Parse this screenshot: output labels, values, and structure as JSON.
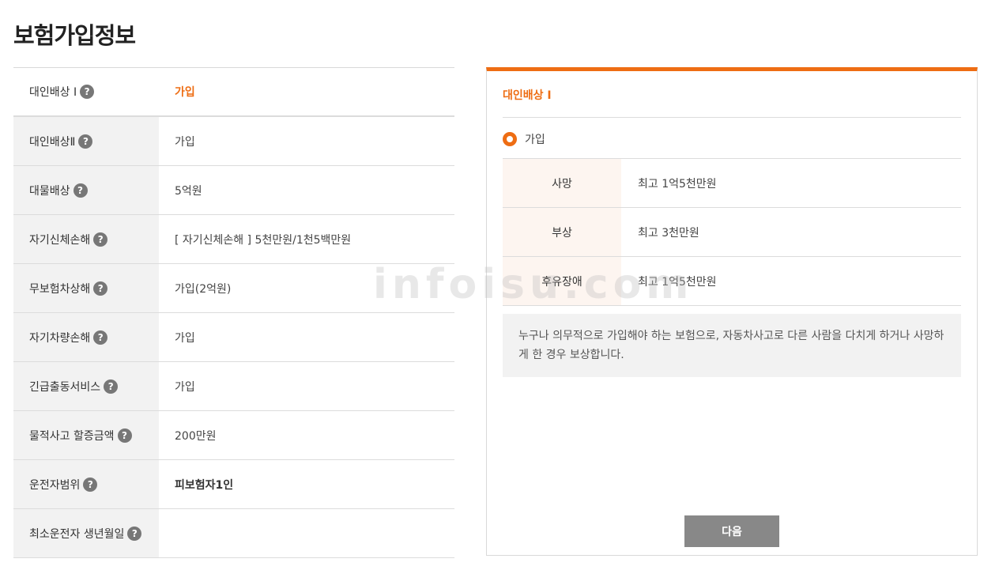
{
  "page_title": "보험가입정보",
  "coverage_rows": [
    {
      "label": "대인배상 Ⅰ",
      "value": "가입"
    },
    {
      "label": "대인배상Ⅱ",
      "value": "가입"
    },
    {
      "label": "대물배상",
      "value": "5억원"
    },
    {
      "label": "자기신체손해",
      "value": "[ 자기신체손해 ]  5천만원/1천5백만원"
    },
    {
      "label": "무보험차상해",
      "value": "가입(2억원)"
    },
    {
      "label": "자기차량손해",
      "value": "가입"
    },
    {
      "label": "긴급출동서비스",
      "value": "가입"
    },
    {
      "label": "물적사고 할증금액",
      "value": "200만원"
    },
    {
      "label": "운전자범위",
      "value": "피보험자1인"
    },
    {
      "label": "최소운전자 생년월일",
      "value": ""
    }
  ],
  "help_icon_glyph": "?",
  "panel": {
    "title": "대인배상 Ⅰ",
    "radio_label": "가입",
    "details": [
      {
        "label": "사망",
        "value": "최고 1억5천만원"
      },
      {
        "label": "부상",
        "value": "최고 3천만원"
      },
      {
        "label": "후유장애",
        "value": "최고 1억5천만원"
      }
    ],
    "description": "누구나 의무적으로 가입해야 하는 보험으로, 자동차사고로 다른 사람을 다치게 하거나 사망하게 한 경우 보상합니다.",
    "next_button": "다음"
  },
  "watermark": "infoisu.com",
  "colors": {
    "accent": "#ee6d13",
    "label_bg": "#f2f2f2",
    "detail_label_bg": "#fdf5f0",
    "button_bg": "#888888"
  }
}
